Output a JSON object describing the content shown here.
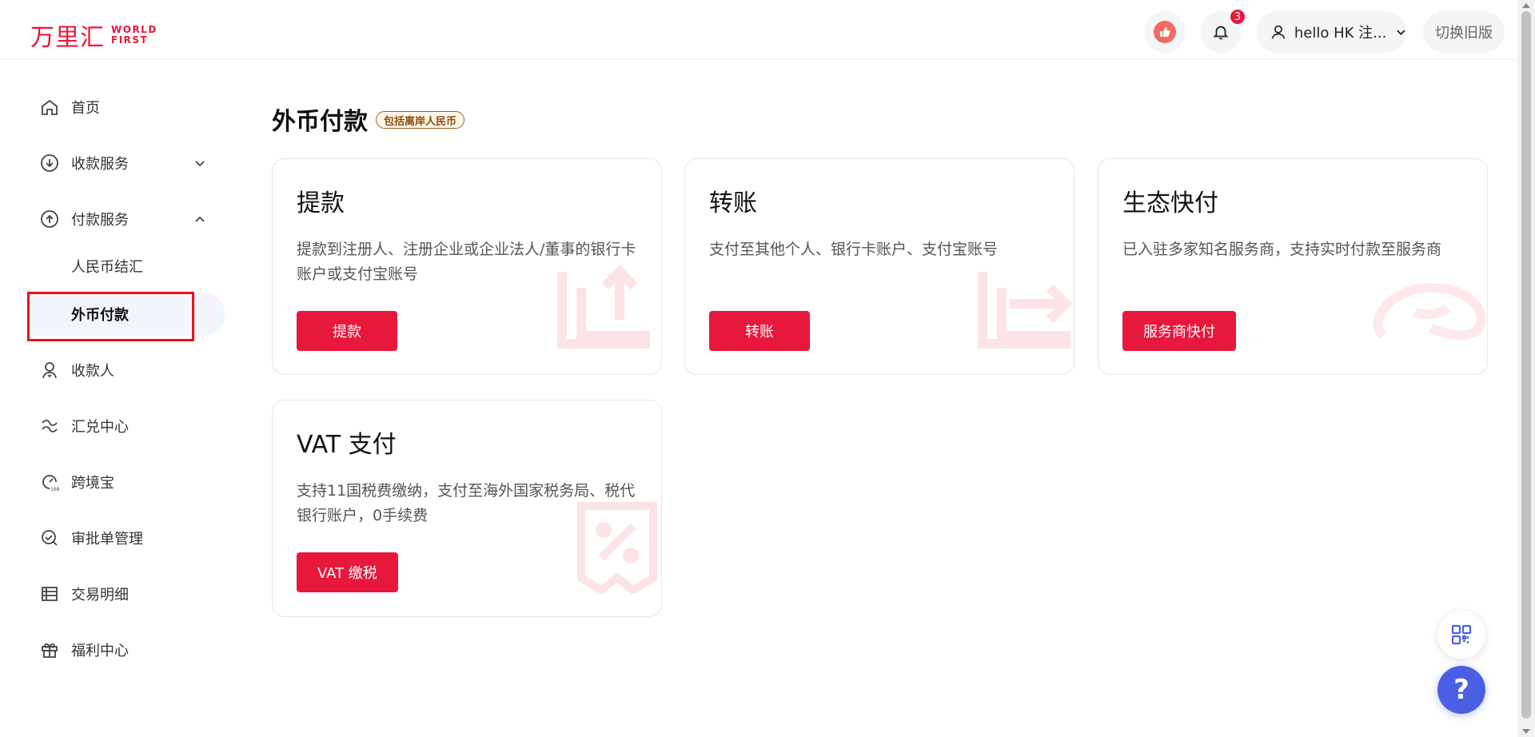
{
  "header": {
    "logo_cn": "万里汇",
    "logo_en_line1": "WORLD",
    "logo_en_line2": "FIRST",
    "notification_count": "3",
    "user_name": "hello HK 注...",
    "switch_old_label": "切换旧版"
  },
  "sidebar": {
    "items": [
      {
        "label": "首页",
        "icon": "home-icon"
      },
      {
        "label": "收款服务",
        "icon": "receive-icon",
        "expanded": false
      },
      {
        "label": "付款服务",
        "icon": "pay-icon",
        "expanded": true
      },
      {
        "label": "收款人",
        "icon": "payee-icon"
      },
      {
        "label": "汇兑中心",
        "icon": "exchange-icon"
      },
      {
        "label": "跨境宝",
        "icon": "kuajingbao-icon"
      },
      {
        "label": "审批单管理",
        "icon": "approval-icon"
      },
      {
        "label": "交易明细",
        "icon": "transactions-icon"
      },
      {
        "label": "福利中心",
        "icon": "gift-icon"
      }
    ],
    "pay_sub_items": [
      {
        "label": "人民币结汇"
      },
      {
        "label": "外币付款",
        "active": true
      }
    ]
  },
  "main": {
    "title": "外币付款",
    "title_tag": "包括离岸人民币",
    "cards": [
      {
        "title": "提款",
        "desc": "提款到注册人、注册企业或企业法人/董事的银行卡账户或支付宝账号",
        "button": "提款"
      },
      {
        "title": "转账",
        "desc": "支付至其他个人、银行卡账户、支付宝账号",
        "button": "转账"
      },
      {
        "title": "生态快付",
        "desc": "已入驻多家知名服务商，支持实时付款至服务商",
        "button": "服务商快付"
      },
      {
        "title": "VAT 支付",
        "desc": "支持11国税费缴纳，支付至海外国家税务局、税代银行账户，0手续费",
        "button": "VAT 缴税"
      }
    ]
  },
  "float": {
    "help_label": "?"
  },
  "colors": {
    "brand_red": "#e8173c",
    "help_blue": "#4a5fe3",
    "active_bg": "#f2f5fc"
  }
}
